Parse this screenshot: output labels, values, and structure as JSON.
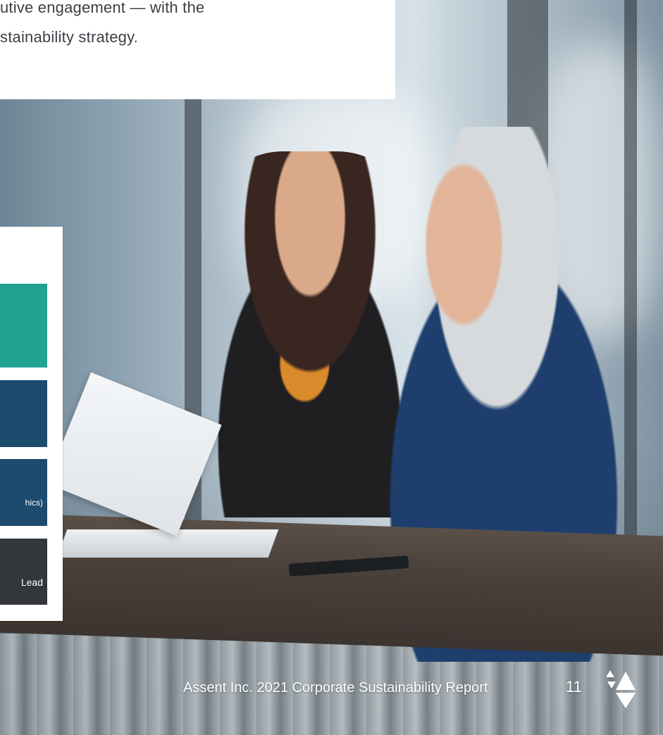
{
  "intro": {
    "line1": "utive engagement — with the",
    "line2": "stainability strategy."
  },
  "panel": {
    "blocks": [
      {
        "text": "",
        "color": "#21a393"
      },
      {
        "text": "",
        "color": "#1d4b6e"
      },
      {
        "text": "hics)",
        "color": "#1d4b6e"
      },
      {
        "text": "Lead",
        "color": "#33363b"
      }
    ]
  },
  "footer": {
    "report": "Assent Inc. 2021 Corporate Sustainability Report",
    "page_number": "11"
  },
  "logo": {
    "icon": "assent-logo-icon"
  }
}
